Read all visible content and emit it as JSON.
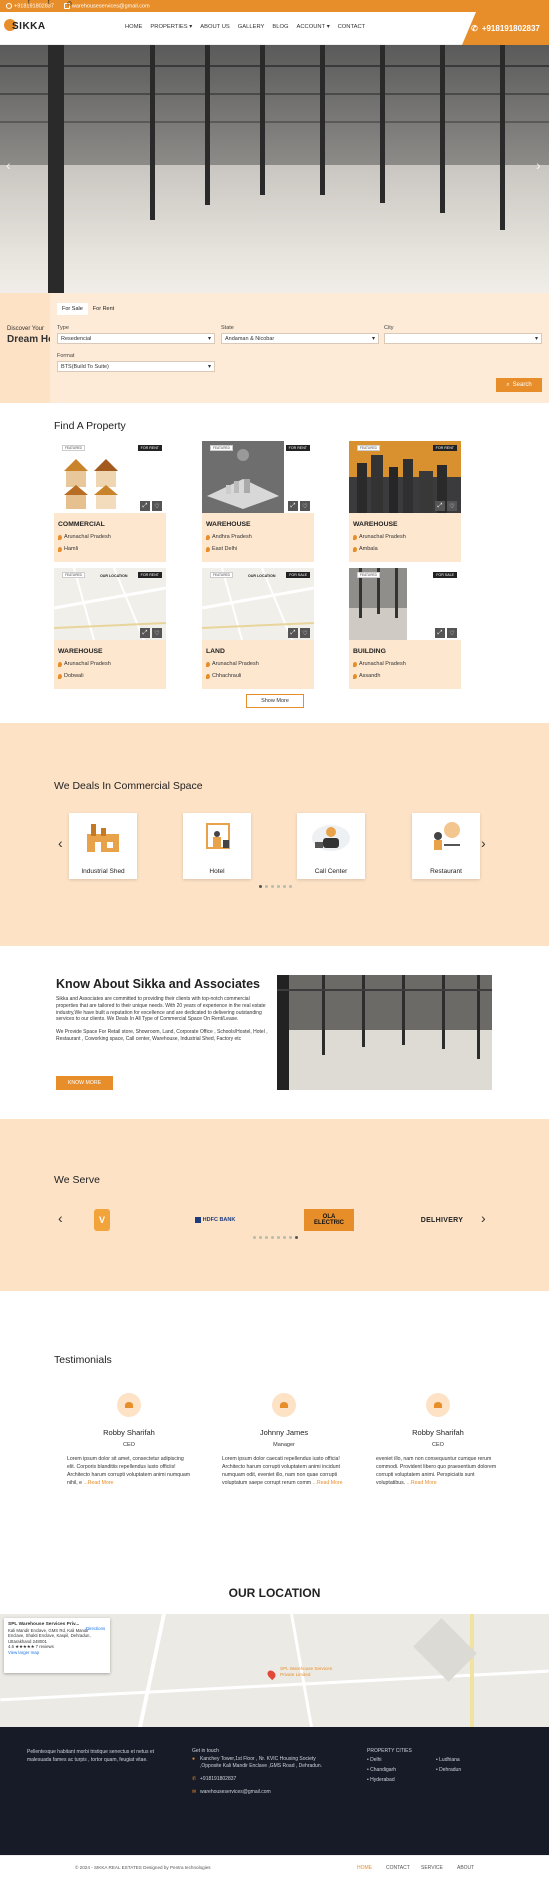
{
  "topbar": {
    "phone": "+918191802837",
    "email": "warehouseservices@gmail.com"
  },
  "nav": {
    "logo_text": "SIKKA",
    "items": [
      "HOME",
      "PROPERTIES",
      "ABOUT US",
      "GALLERY",
      "BLOG",
      "ACCOUNT",
      "CONTACT"
    ],
    "phone": "+918191802837"
  },
  "search": {
    "headline_small": "Discover Your",
    "headline_big": "Dream House",
    "tabs": [
      "For Sale",
      "For Rent"
    ],
    "type_label": "Type",
    "type_value": "Resedencial",
    "state_label": "State",
    "state_value": "Andaman & Nicobar",
    "city_label": "City",
    "city_value": "",
    "format_label": "Format",
    "format_value": "BTS(Build To Suite)",
    "button": "Search"
  },
  "find": {
    "title": "Find A Property",
    "cards": [
      {
        "title": "COMMERCIAL",
        "state": "Arunachal Pradesh",
        "city": "Hamli",
        "badge": "FOR RENT",
        "featured": "FEATURED"
      },
      {
        "title": "WAREHOUSE",
        "state": "Andhra Pradesh",
        "city": "East Delhi",
        "badge": "FOR RENT",
        "featured": "FEATURED"
      },
      {
        "title": "WAREHOUSE",
        "state": "Arunachal Pradesh",
        "city": "Ambala",
        "badge": "FOR RENT",
        "featured": "FEATURED"
      },
      {
        "title": "WAREHOUSE",
        "state": "Arunachal Pradesh",
        "city": "Dobwali",
        "badge": "FOR RENT",
        "featured": "FEATURED",
        "map_label": "OUR LOCATION"
      },
      {
        "title": "LAND",
        "state": "Arunachal Pradesh",
        "city": "Chhachrauli",
        "badge": "FOR SALE",
        "featured": "FEATURED",
        "map_label": "OUR LOCATION"
      },
      {
        "title": "BUILDING",
        "state": "Arunachal Pradesh",
        "city": "Assandh",
        "badge": "FOR SALE",
        "featured": "FEATURED"
      }
    ],
    "show_more": "Show More"
  },
  "deals": {
    "title": "We Deals In Commercial Space",
    "items": [
      "Industrial Shed",
      "Hotel",
      "Call Center",
      "Restaurant"
    ]
  },
  "about": {
    "title": "Know About Sikka and Associates",
    "p1": "Sikka and Associates are committed to providing their clients with top-notch commercial properties that are tailored to their unique needs. With 20 years of experience in the real estate industry,We have built a reputation for excellence and are dedicated to delivering outstanding services to our clients. We Deals In All Type of Commercial Space On Rent/Lease.",
    "p2": "We Provide Space For Retail store, Showroom, Land, Corporate Office , Schools/Hostel, Hotel , Restaurant , Coworking space, Call center, Warehouse, Industrial Shed, Factory etc",
    "button": "KNOW MORE"
  },
  "serve": {
    "title": "We Serve",
    "brands": [
      "HDFC BANK",
      "OLA ELECTRIC",
      "DELHIVERY"
    ]
  },
  "testimonials": {
    "title": "Testimonials",
    "items": [
      {
        "name": "Robby Sharifah",
        "role": "CEO",
        "text": "Lorem ipsum dolor sit amet, consectetur adipiscing elit. Corporis blanditiis repellendus iusto officiis! Architecto harum corrupti voluptatem animi numquam nihil, e",
        "more": "...Read More"
      },
      {
        "name": "Johnny James",
        "role": "Manager",
        "text": "Lorem ipsum dolor caecati repellendus iusto officia! Architecto harum corrupti voluptatem animi incidunt numquam odit, eveniet illo, nam non quae corrupti voluptatum saepe corrupt rerum comm",
        "more": "...Read More"
      },
      {
        "name": "Robby Sharifah",
        "role": "CEO",
        "text": "eveniet illo, nam non consequuntur cumque rerum commodi. Provident libero quo praesentium dolorem corrupti voluptatem animi. Perspiciatis sunt voluptatibus.",
        "more": "...Read More"
      }
    ]
  },
  "location": {
    "title": "OUR LOCATION",
    "info_name": "SPL Warehouse Services Priv...",
    "info_addr": "Kali Mandir Enclave, GMS Rd, Kali Mandir Enclave, Shakti Enclave, Kaspil, Dehradun, Uttarakhand 248001",
    "info_rating": "4.6 ★★★★★ 7 reviews",
    "info_link": "View larger map",
    "directions": "Directions",
    "pin_label": "SPL Warehouse Services Private Limited"
  },
  "footer": {
    "about": "Pellentesque habitant morbi tristique senectus et netus et malesuada fames ac turpis , tortor quam, feugiat vitae.",
    "touch_title": "Get in touch",
    "address": "Kanchey Tower,1st Floor , Nr. KVIC Housing Society ,Opposite Kali Mandir Enclave ,GMS Road , Dehradun.",
    "phone": "+918191802837",
    "email": "warehouseservices@gmail.com",
    "cities_title": "PROPERTY CITIES",
    "cities_left": [
      "Delhi",
      "Chandigarh",
      "Hyderabad"
    ],
    "cities_right": [
      "Ludhiana",
      "Dehradun"
    ],
    "copyright": "© 2024 - SIKKA REAL ESTATES Designed by Pentra technologies",
    "links": [
      "HOME",
      "CONTACT",
      "SERVICE",
      "ABOUT"
    ]
  },
  "colors": {
    "accent": "#e78e2b",
    "peach": "#fde2c6",
    "footer": "#171b27"
  }
}
